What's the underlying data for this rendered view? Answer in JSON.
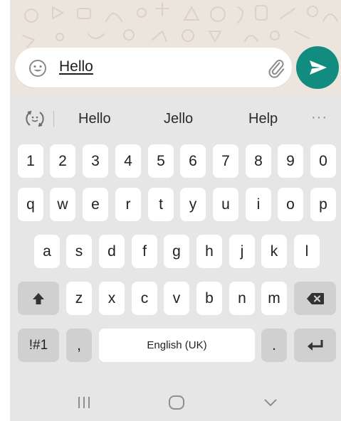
{
  "composer": {
    "message": "Hello",
    "emoji_icon": "emoji-icon",
    "attach_icon": "paperclip-icon",
    "send_icon": "send-icon"
  },
  "colors": {
    "accent": "#128c7e",
    "wallpaper": "#ece5dd",
    "keyboard_bg": "#e6e6e6",
    "key_bg": "#ffffff",
    "fn_key_bg": "#d0d0d0"
  },
  "suggestions": [
    "Hello",
    "Jello",
    "Help"
  ],
  "suggestion_more": "···",
  "keyboard": {
    "number_row": [
      "1",
      "2",
      "3",
      "4",
      "5",
      "6",
      "7",
      "8",
      "9",
      "0"
    ],
    "row1": [
      "q",
      "w",
      "e",
      "r",
      "t",
      "y",
      "u",
      "i",
      "o",
      "p"
    ],
    "row2": [
      "a",
      "s",
      "d",
      "f",
      "g",
      "h",
      "j",
      "k",
      "l"
    ],
    "row3": [
      "z",
      "x",
      "c",
      "v",
      "b",
      "n",
      "m"
    ],
    "symbols_label": "!#1",
    "comma_label": ",",
    "space_label": "English (UK)",
    "period_label": ".",
    "shift_icon": "shift-icon",
    "backspace_icon": "backspace-icon",
    "enter_icon": "enter-icon"
  },
  "nav": {
    "recents_icon": "recents-icon",
    "home_icon": "home-icon",
    "hide_keyboard_icon": "chevron-down-icon"
  }
}
